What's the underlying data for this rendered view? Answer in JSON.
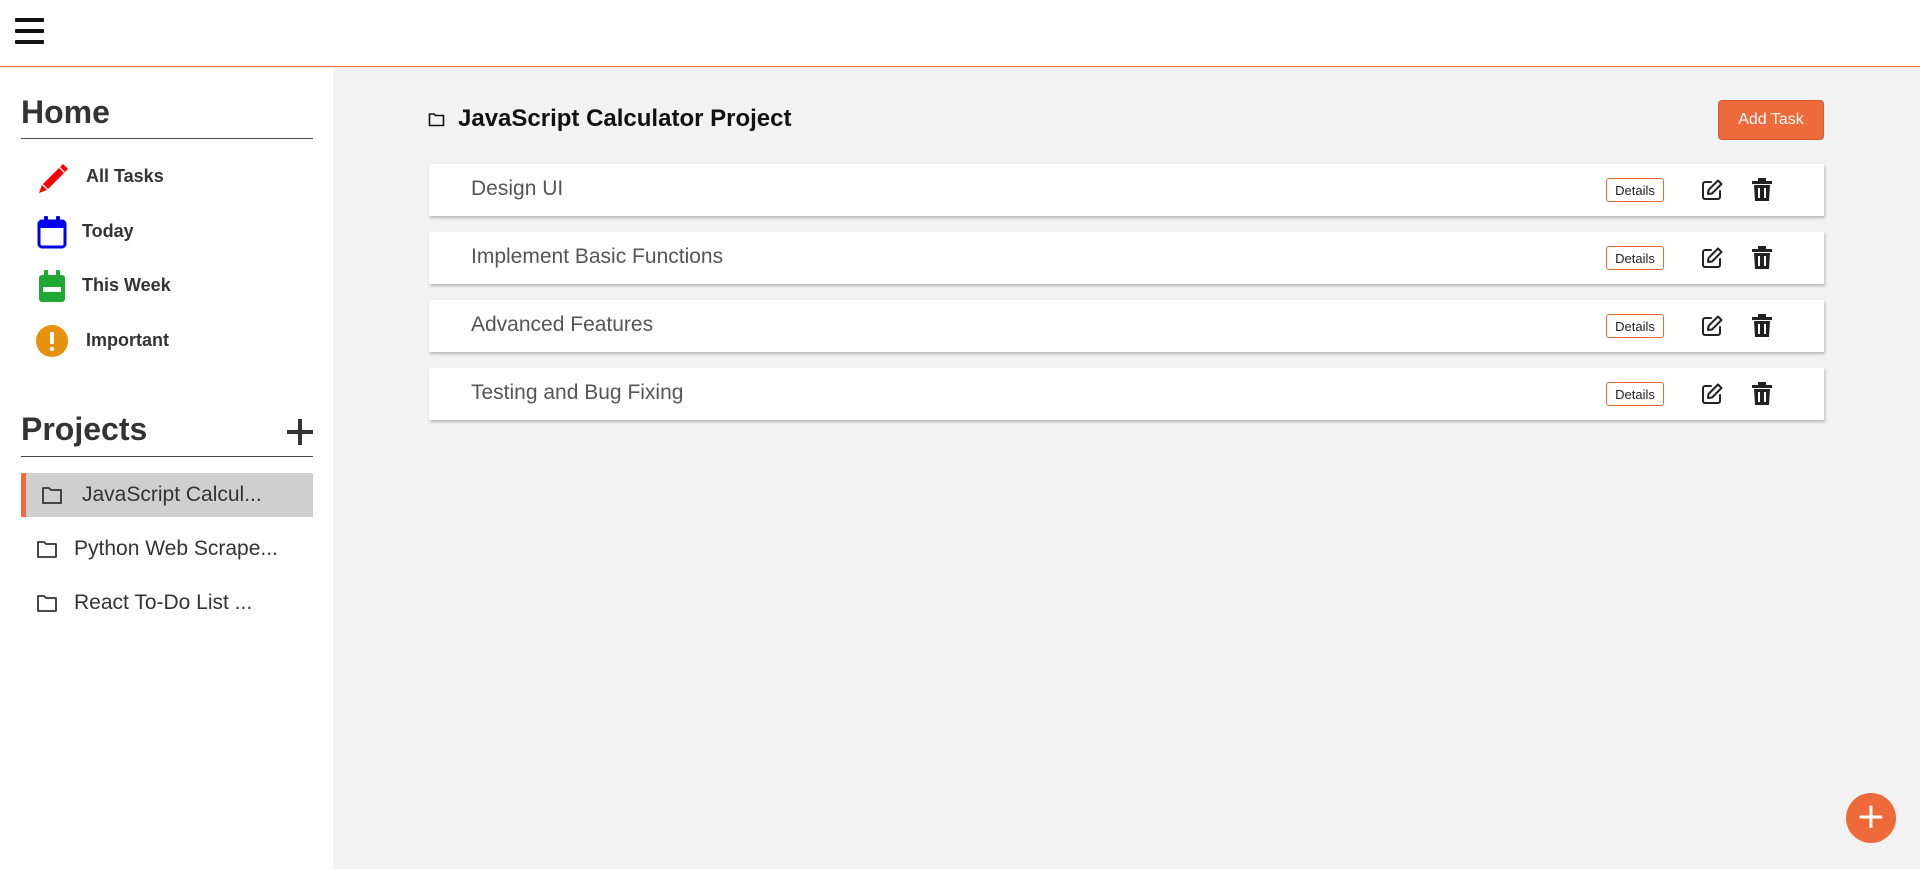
{
  "header": {
    "menu_icon": "hamburger-icon"
  },
  "sidebar": {
    "home_title": "Home",
    "nav": [
      {
        "label": "All Tasks",
        "icon": "pencil-icon",
        "color": "#ff0000"
      },
      {
        "label": "Today",
        "icon": "calendar-icon",
        "color": "#0000ee"
      },
      {
        "label": "This Week",
        "icon": "calendar-week-icon",
        "color": "#1fa832"
      },
      {
        "label": "Important",
        "icon": "exclamation-icon",
        "color": "#e8910c"
      }
    ],
    "projects_title": "Projects",
    "projects": [
      {
        "label": "JavaScript Calcul...",
        "active": true
      },
      {
        "label": "Python Web Scrape...",
        "active": false
      },
      {
        "label": "React To-Do List ...",
        "active": false
      }
    ]
  },
  "main": {
    "project_title": "JavaScript Calculator Project",
    "add_task_label": "Add Task",
    "tasks": [
      {
        "name": "Design UI",
        "details_label": "Details"
      },
      {
        "name": "Implement Basic Functions",
        "details_label": "Details"
      },
      {
        "name": "Advanced Features",
        "details_label": "Details"
      },
      {
        "name": "Testing and Bug Fixing",
        "details_label": "Details"
      }
    ]
  },
  "fab": {
    "label": "+"
  },
  "colors": {
    "accent": "#ee6a3a",
    "active_project_bg": "#cfcfcf",
    "main_bg": "#f2f2f2"
  }
}
